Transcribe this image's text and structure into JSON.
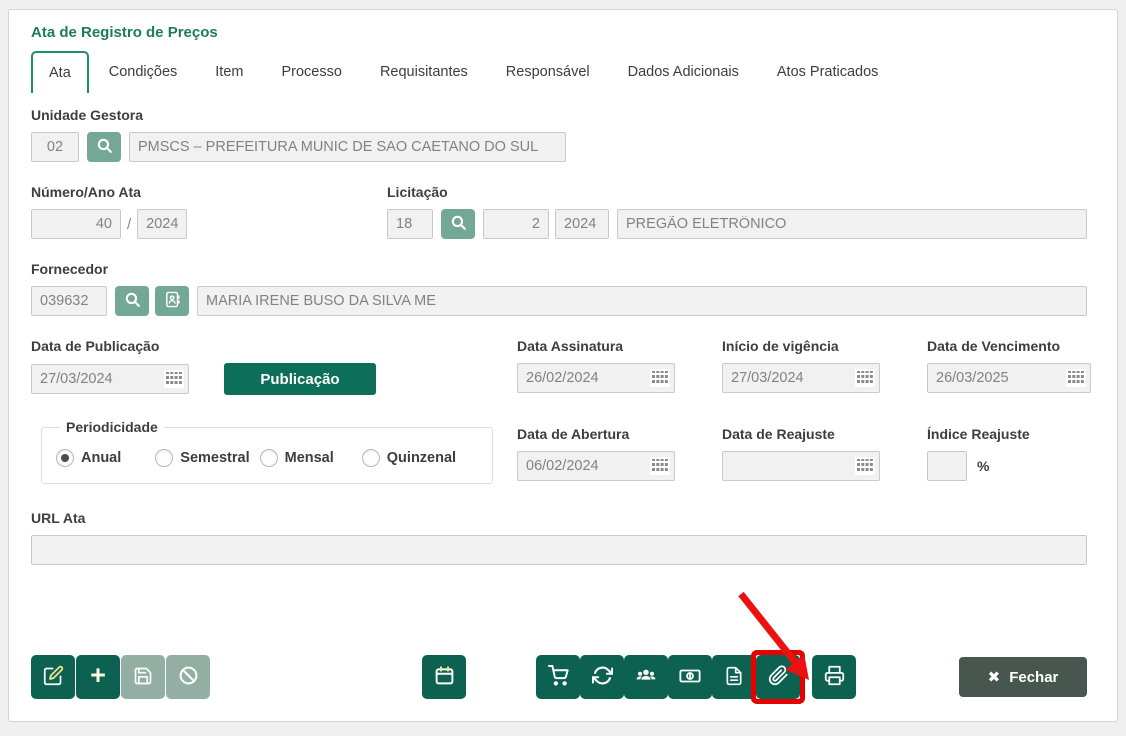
{
  "window": {
    "title": "Ata de Registro de Preços"
  },
  "tabs": [
    {
      "label": "Ata",
      "active": true
    },
    {
      "label": "Condições",
      "active": false
    },
    {
      "label": "Item",
      "active": false
    },
    {
      "label": "Processo",
      "active": false
    },
    {
      "label": "Requisitantes",
      "active": false
    },
    {
      "label": "Responsável",
      "active": false
    },
    {
      "label": "Dados Adicionais",
      "active": false
    },
    {
      "label": "Atos Praticados",
      "active": false
    }
  ],
  "fields": {
    "unidade_gestora": {
      "label": "Unidade Gestora",
      "code": "02",
      "name": "PMSCS – PREFEITURA MUNIC DE SAO CAETANO DO SUL"
    },
    "numero_ano": {
      "label": "Número/Ano Ata",
      "numero": "40",
      "separator": "/",
      "ano": "2024"
    },
    "licitacao": {
      "label": "Licitação",
      "numero": "18",
      "seq": "2",
      "ano": "2024",
      "modalidade": "PREGÃO ELETRÔNICO"
    },
    "fornecedor": {
      "label": "Fornecedor",
      "code": "039632",
      "name": "MARIA IRENE BUSO DA SILVA ME"
    },
    "data_publicacao": {
      "label": "Data de Publicação",
      "value": "27/03/2024"
    },
    "publicacao_button": "Publicação",
    "data_assinatura": {
      "label": "Data Assinatura",
      "value": "26/02/2024"
    },
    "inicio_vigencia": {
      "label": "Início de vigência",
      "value": "27/03/2024"
    },
    "data_vencimento": {
      "label": "Data de Vencimento",
      "value": "26/03/2025"
    },
    "periodicidade": {
      "label": "Periodicidade",
      "options": [
        "Anual",
        "Semestral",
        "Mensal",
        "Quinzenal"
      ],
      "selected": "Anual"
    },
    "data_abertura": {
      "label": "Data de Abertura",
      "value": "06/02/2024"
    },
    "data_reajuste": {
      "label": "Data de Reajuste",
      "value": ""
    },
    "indice_reajuste": {
      "label": "Índice Reajuste",
      "value": "",
      "suffix": "%"
    },
    "url_ata": {
      "label": "URL Ata",
      "value": ""
    }
  },
  "footer": {
    "add_glyph": "+",
    "close_glyph": "✖",
    "fechar_label": "Fechar"
  },
  "icons": {
    "search": "magnifier",
    "contact": "address-book",
    "date_field": "calendar-grid",
    "edit": "pencil-square",
    "add": "plus",
    "save": "floppy-disk",
    "cancel": "circle-slash",
    "schedule": "calendar",
    "cart": "shopping-cart",
    "refresh": "sync-arrows",
    "participants": "users-group",
    "values": "money-bill",
    "document": "file-text",
    "attachment": "paperclip",
    "print": "printer",
    "close": "x-mark"
  },
  "colors": {
    "title_green": "#1e7a61",
    "tab_border_green": "#1f8e6d",
    "button_dark_green": "#0d6151",
    "button_muted_green": "#73a796",
    "button_disabled": "#93afa4",
    "publish_green": "#0d6f59",
    "close_gray": "#47564f",
    "highlight_red": "#e60000"
  }
}
